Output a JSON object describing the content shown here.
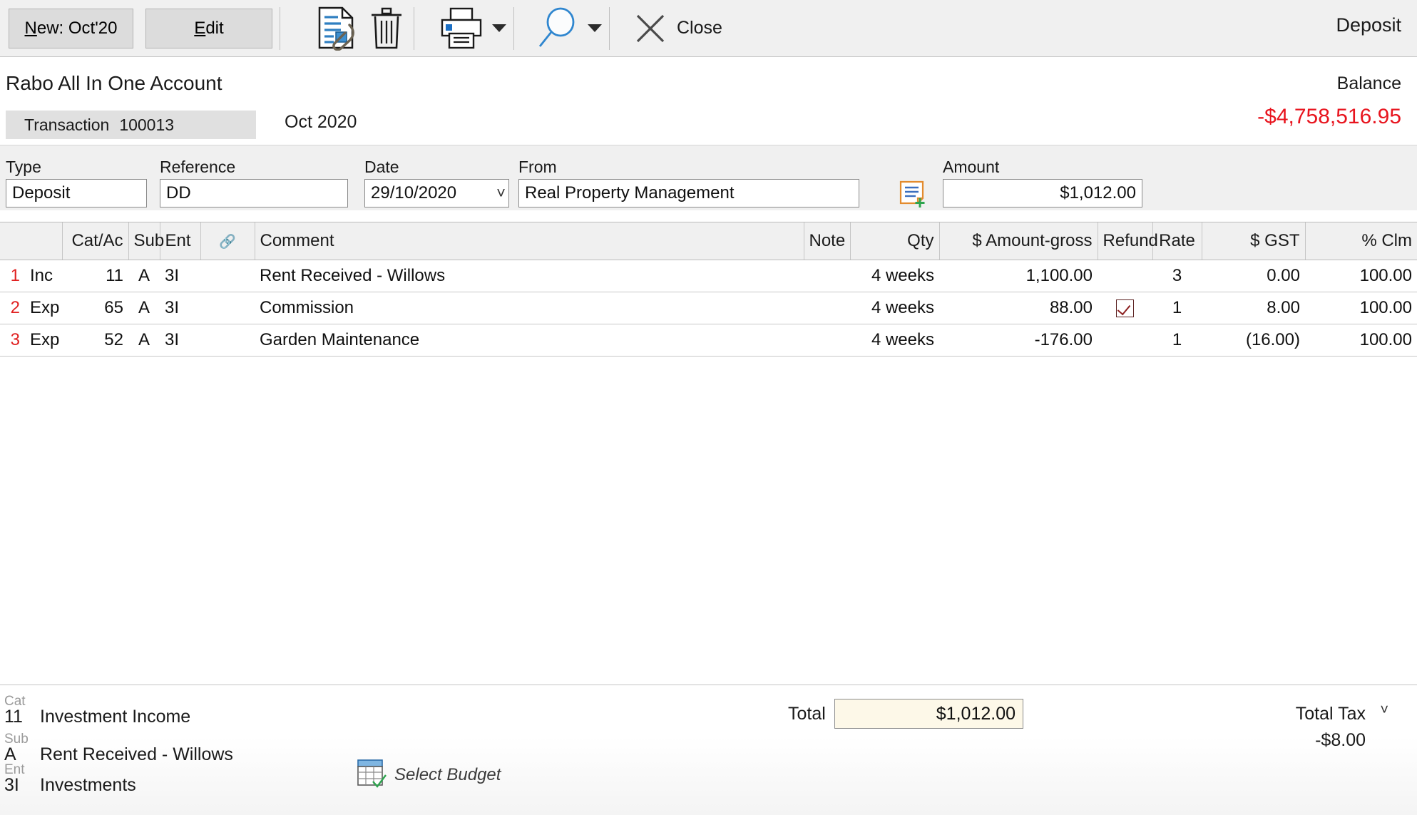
{
  "toolbar": {
    "new_label": "New: Oct'20",
    "new_accel": "N",
    "edit_label": "Edit",
    "edit_accel": "E",
    "close_label": "Close",
    "icons": [
      "attachment-document-icon",
      "delete-trash-icon",
      "print-icon",
      "search-icon",
      "close-x-icon"
    ],
    "doc_type_title": "Deposit"
  },
  "header": {
    "account_name": "Rabo All In One Account",
    "balance_label": "Balance",
    "balance_value": "-$4,758,516.95",
    "balance_color": "#e8141e",
    "tab_label": "Transaction",
    "tab_number": "100013",
    "period": "Oct 2020"
  },
  "form": {
    "type": {
      "label": "Type",
      "value": "Deposit"
    },
    "reference": {
      "label": "Reference",
      "value": "DD"
    },
    "date": {
      "label": "Date",
      "value": "29/10/2020"
    },
    "from": {
      "label": "From",
      "value": "Real Property Management"
    },
    "amount": {
      "label": "Amount",
      "value": "$1,012.00"
    },
    "note_add_icon": "add-note-icon"
  },
  "grid": {
    "columns": [
      {
        "key": "rowno",
        "label": ""
      },
      {
        "key": "catac",
        "label": "Cat/Ac"
      },
      {
        "key": "sub",
        "label": "Sub"
      },
      {
        "key": "ent",
        "label": "Ent"
      },
      {
        "key": "link",
        "label": "link-icon"
      },
      {
        "key": "comment",
        "label": "Comment"
      },
      {
        "key": "note",
        "label": "Note"
      },
      {
        "key": "qty",
        "label": "Qty"
      },
      {
        "key": "amount",
        "label": "$ Amount-gross"
      },
      {
        "key": "refund",
        "label": "Refund"
      },
      {
        "key": "rate",
        "label": "Rate"
      },
      {
        "key": "gst",
        "label": "$ GST"
      },
      {
        "key": "clm",
        "label": "% Clm"
      }
    ],
    "rows": [
      {
        "line": "1",
        "type": "Inc",
        "catac": "11",
        "sub": "A",
        "ent": "3I",
        "comment": "Rent Received - Willows",
        "note": "",
        "qty": "4 weeks",
        "amount": "1,100.00",
        "refund": false,
        "rate": "3",
        "gst": "0.00",
        "clm": "100.00"
      },
      {
        "line": "2",
        "type": "Exp",
        "catac": "65",
        "sub": "A",
        "ent": "3I",
        "comment": "Commission",
        "note": "",
        "qty": "4 weeks",
        "amount": "88.00",
        "refund": true,
        "rate": "1",
        "gst": "8.00",
        "clm": "100.00"
      },
      {
        "line": "3",
        "type": "Exp",
        "catac": "52",
        "sub": "A",
        "ent": "3I",
        "comment": "Garden Maintenance",
        "note": "",
        "qty": "4 weeks",
        "amount": "-176.00",
        "refund": false,
        "rate": "1",
        "gst": "(16.00)",
        "clm": "100.00"
      }
    ]
  },
  "footer": {
    "cat_tag": "Cat",
    "cat_code": "11",
    "cat_desc": "Investment Income",
    "sub_tag": "Sub",
    "sub_code": "A",
    "sub_desc": "Rent Received - Willows",
    "ent_tag": "Ent",
    "ent_code": "3I",
    "ent_desc": "Investments",
    "total_label": "Total",
    "total_value": "$1,012.00",
    "total_tax_label": "Total Tax",
    "total_tax_value": "-$8.00",
    "select_budget_label": "Select Budget",
    "select_budget_icon": "budget-grid-icon"
  }
}
